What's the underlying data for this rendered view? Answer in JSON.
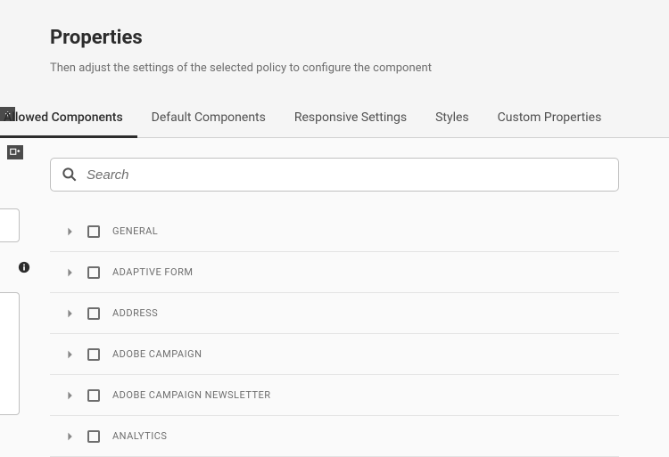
{
  "header": {
    "title": "Properties",
    "subtitle": "Then adjust the settings of the selected policy to configure the component"
  },
  "tabs": {
    "t0": "Allowed Components",
    "t1": "Default Components",
    "t2": "Responsive Settings",
    "t3": "Styles",
    "t4": "Custom Properties"
  },
  "search": {
    "placeholder": "Search"
  },
  "groups": {
    "g0": "GENERAL",
    "g1": "ADAPTIVE FORM",
    "g2": "ADDRESS",
    "g3": "ADOBE CAMPAIGN",
    "g4": "ADOBE CAMPAIGN NEWSLETTER",
    "g5": "ANALYTICS"
  }
}
